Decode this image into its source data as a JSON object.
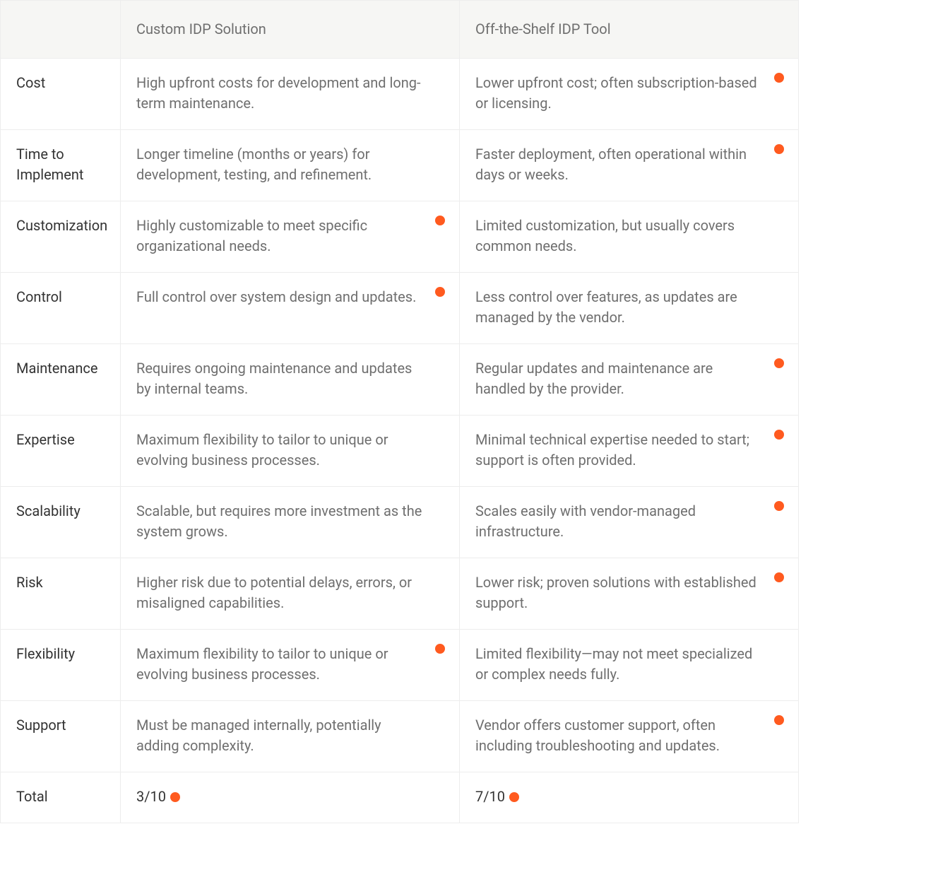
{
  "colors": {
    "accent": "#ff5a1f"
  },
  "table": {
    "headers": {
      "empty": "",
      "custom": "Custom IDP Solution",
      "off": "Off-the-Shelf IDP Tool"
    },
    "rows": [
      {
        "label": "Cost",
        "custom": {
          "text": "High upfront costs for development and long-term maintenance.",
          "dot": false
        },
        "off": {
          "text": "Lower upfront cost; often subscription-based or licensing.",
          "dot": true
        }
      },
      {
        "label": "Time to Implement",
        "custom": {
          "text": "Longer timeline (months or years) for development, testing, and refinement.",
          "dot": false
        },
        "off": {
          "text": "Faster deployment, often operational within days or weeks.",
          "dot": true
        }
      },
      {
        "label": "Customization",
        "custom": {
          "text": "Highly customizable to meet specific organizational needs.",
          "dot": true
        },
        "off": {
          "text": "Limited customization, but usually covers common needs.",
          "dot": false
        }
      },
      {
        "label": "Control",
        "custom": {
          "text": "Full control over system design and updates.",
          "dot": true
        },
        "off": {
          "text": "Less control over features, as updates are managed by the vendor.",
          "dot": false
        }
      },
      {
        "label": "Maintenance",
        "custom": {
          "text": "Requires ongoing maintenance and updates by internal teams.",
          "dot": false
        },
        "off": {
          "text": "Regular updates and maintenance are handled by the provider.",
          "dot": true
        }
      },
      {
        "label": "Expertise",
        "custom": {
          "text": "Maximum flexibility to tailor to unique or evolving business processes.",
          "dot": false
        },
        "off": {
          "text": "Minimal technical expertise needed to start; support is often provided.",
          "dot": true
        }
      },
      {
        "label": "Scalability",
        "custom": {
          "text": "Scalable, but requires more investment as the system grows.",
          "dot": false
        },
        "off": {
          "text": "Scales easily with vendor-managed infrastructure.",
          "dot": true
        }
      },
      {
        "label": "Risk",
        "custom": {
          "text": "Higher risk due to potential delays, errors, or misaligned capabilities.",
          "dot": false
        },
        "off": {
          "text": "Lower risk; proven solutions with established support.",
          "dot": true
        }
      },
      {
        "label": "Flexibility",
        "custom": {
          "text": "Maximum flexibility to tailor to unique or evolving business processes.",
          "dot": true
        },
        "off": {
          "text": "Limited flexibility—may not meet specialized or complex needs fully.",
          "dot": false
        }
      },
      {
        "label": "Support",
        "custom": {
          "text": "Must be managed internally, potentially adding complexity.",
          "dot": false
        },
        "off": {
          "text": "Vendor offers customer support, often including troubleshooting and updates.",
          "dot": true
        }
      }
    ],
    "total": {
      "label": "Total",
      "custom": "3/10",
      "off": "7/10"
    }
  }
}
